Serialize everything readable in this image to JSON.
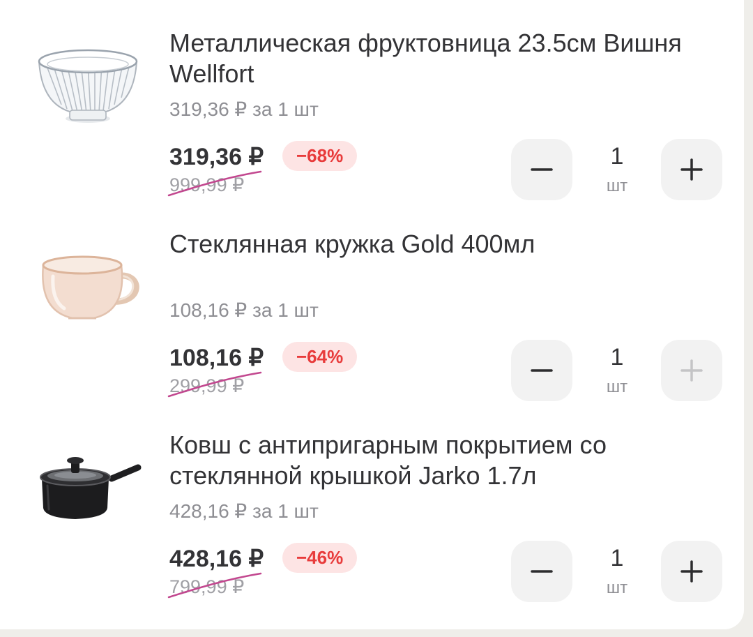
{
  "items": [
    {
      "title": "Металлическая фруктовница 23.5см Вишня Wellfort",
      "unit_price": "319,36 ₽ за 1 шт",
      "price": "319,36 ₽",
      "discount": "−68%",
      "old_price": "999,99 ₽",
      "quantity": "1",
      "quantity_unit": "шт",
      "plus_enabled": true,
      "image": "wire-fruit-bowl"
    },
    {
      "title": "Стеклянная кружка Gold 400мл",
      "unit_price": "108,16 ₽ за 1 шт",
      "price": "108,16 ₽",
      "discount": "−64%",
      "old_price": "299,99 ₽",
      "quantity": "1",
      "quantity_unit": "шт",
      "plus_enabled": false,
      "image": "glass-mug"
    },
    {
      "title": "Ковш с антипригарным покрытием со стеклянной крышкой Jarko 1.7л",
      "unit_price": "428,16 ₽ за 1 шт",
      "price": "428,16 ₽",
      "discount": "−46%",
      "old_price": "799,99 ₽",
      "quantity": "1",
      "quantity_unit": "шт",
      "plus_enabled": true,
      "image": "saucepan-with-lid"
    }
  ],
  "colors": {
    "discount_text": "#e83b3b",
    "discount_bg": "#fde4e4",
    "strike_line": "#c2478f",
    "button_bg": "#f2f2f2",
    "disabled_icon": "#c4c4c6"
  }
}
